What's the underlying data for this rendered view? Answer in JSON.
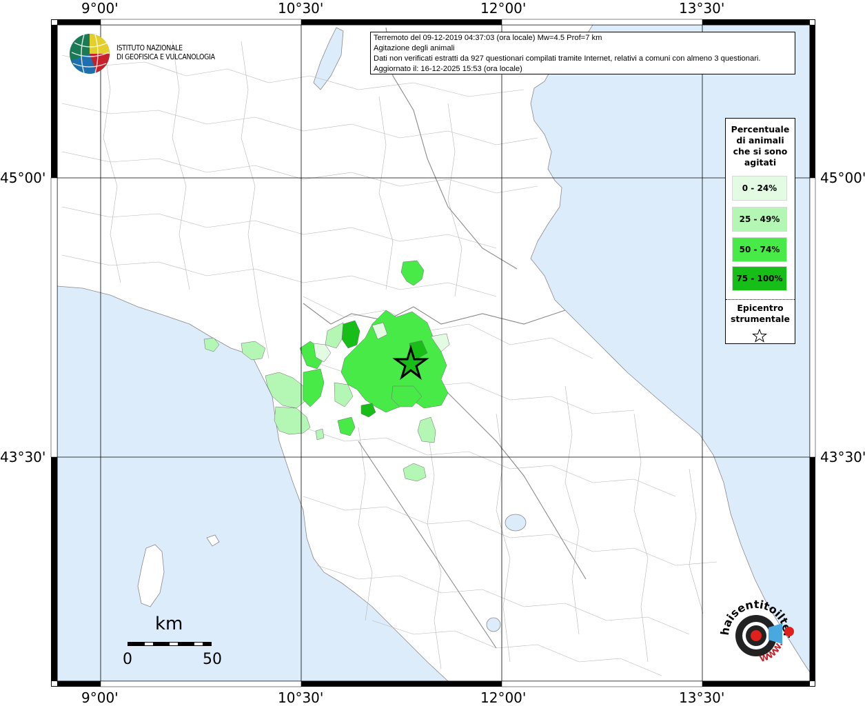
{
  "axes": {
    "top_lon_labels": [
      "9°00'",
      "10°30'",
      "12°00'",
      "13°30'"
    ],
    "bottom_lon_labels": [
      "9°00'",
      "10°30'",
      "12°00'",
      "13°30'"
    ],
    "left_lat_labels": [
      "45°00'",
      "43°30'"
    ],
    "right_lat_labels": [
      "45°00'",
      "43°30'"
    ]
  },
  "info": {
    "line1": "Terremoto del 09-12-2019 04:37:03 (ora locale) Mw=4.5 Prof=7 km",
    "line2": "Agitazione degli animali",
    "line3": "Dati non verificati estratti da 927 questionari compilati tramite Internet, relativi a comuni con almeno 3 questionari.",
    "line4": "Aggiornato il: 16-12-2025 15:53 (ora locale)"
  },
  "legend": {
    "title_line1": "Percentuale",
    "title_line2": "di animali",
    "title_line3": "che si sono",
    "title_line4": "agitati",
    "classes": [
      {
        "label": "0 - 24%",
        "color": "#e2fbe2"
      },
      {
        "label": "25 - 49%",
        "color": "#b4f7b4"
      },
      {
        "label": "50 - 74%",
        "color": "#48ea48"
      },
      {
        "label": "75 - 100%",
        "color": "#18be18"
      }
    ],
    "epicenter_line1": "Epicentro",
    "epicenter_line2": "strumentale"
  },
  "ingv": {
    "line1": "ISTITUTO NAZIONALE",
    "line2": "DI GEOFISICA E VULCANOLOGIA"
  },
  "scale": {
    "unit": "km",
    "start": "0",
    "end": "50"
  },
  "hst_logo": {
    "text": "haisentitoilterremoto.it",
    "url_text": "WWW."
  },
  "colors": {
    "sea": "#dcecfa",
    "land": "#ffffff",
    "borders": "#9a9a9a",
    "grid": "#000000"
  }
}
